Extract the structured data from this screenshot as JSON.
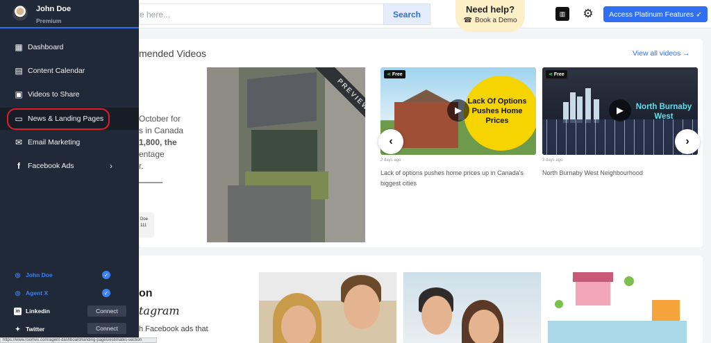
{
  "search": {
    "placeholder_visible": "e here...",
    "button": "Search"
  },
  "help": {
    "title": "Need help?",
    "subtitle": "Book a Demo"
  },
  "header": {
    "platinum_button": "Access Platinum Features"
  },
  "sidebar": {
    "user_name": "John Doe",
    "user_plan": "Premium",
    "items": [
      {
        "label": "Dashboard",
        "icon": "grid-icon"
      },
      {
        "label": "Content Calendar",
        "icon": "calendar-icon"
      },
      {
        "label": "Videos to Share",
        "icon": "video-icon"
      },
      {
        "label": "News & Landing Pages",
        "icon": "newspaper-icon"
      },
      {
        "label": "Email Marketing",
        "icon": "mail-icon"
      },
      {
        "label": "Facebook Ads",
        "icon": "facebook-icon"
      }
    ],
    "accounts": [
      {
        "label": "John Doe",
        "icon": "instagram-icon",
        "connected": true
      },
      {
        "label": "Agent X",
        "icon": "instagram-icon",
        "connected": true
      },
      {
        "label": "Linkedin",
        "icon": "linkedin-icon",
        "action": "Connect"
      },
      {
        "label": "Twitter",
        "icon": "twitter-icon",
        "action": "Connect"
      }
    ]
  },
  "videos": {
    "section_title": "mended Videos",
    "view_all": "View all videos",
    "featured_text": [
      "October for",
      "s in Canada",
      "1,800, the",
      "entage",
      "r."
    ],
    "featured_author": [
      "Doe",
      "111"
    ],
    "preview_label": "PREVIEW",
    "cards": [
      {
        "badge": "Free",
        "caption": "Lack Of Options Pushes Home Prices",
        "age": "2 days ago",
        "title": "Lack of options pushes home prices up in Canada's biggest cities"
      },
      {
        "badge": "Free",
        "caption": "North Burnaby West",
        "age": "3 days ago",
        "title": "North Burnaby West Neighbourhood"
      }
    ]
  },
  "ads": {
    "title": "on",
    "subtitle": "tagram",
    "text": "h Facebook ads that"
  },
  "status_url": "https://www.roomvu.com/agent-dashboard/landing-pages/estimates-section",
  "colors": {
    "accent": "#2f6ff0",
    "sidebar": "#1f2937",
    "highlight": "#e11d2a"
  }
}
